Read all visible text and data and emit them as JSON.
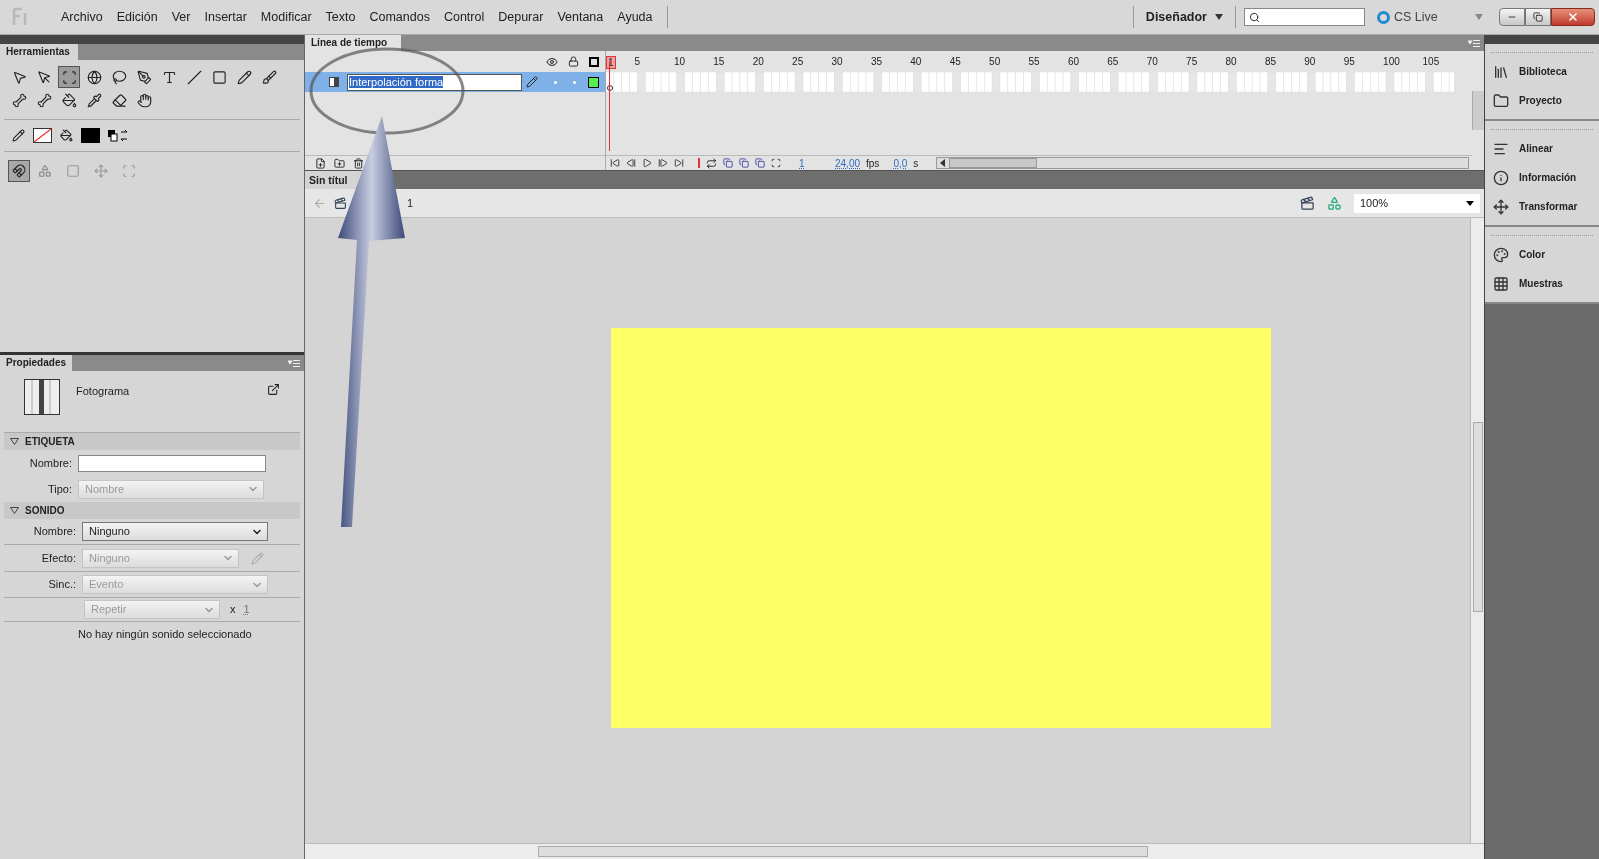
{
  "menu": {
    "items": [
      "Archivo",
      "Edición",
      "Ver",
      "Insertar",
      "Modificar",
      "Texto",
      "Comandos",
      "Control",
      "Depurar",
      "Ventana",
      "Ayuda"
    ],
    "workspace": "Diseñador",
    "cs_live": "CS Live"
  },
  "tools_panel": {
    "title": "Herramientas",
    "tools": [
      {
        "selected": false
      },
      {
        "selected": false
      },
      {
        "selected": true
      },
      {
        "selected": false
      },
      {
        "selected": false
      },
      {
        "selected": false
      },
      {
        "selected": false
      },
      {
        "selected": false
      },
      {
        "selected": false
      },
      {
        "selected": false
      },
      {
        "selected": false
      },
      {
        "selected": false
      },
      {
        "selected": false
      },
      {
        "selected": false
      },
      {
        "selected": false
      },
      {
        "selected": false
      },
      {
        "selected": false
      }
    ],
    "snap": {
      "on": true
    }
  },
  "timeline": {
    "title": "Línea de tiempo",
    "frame_labels": [
      "1",
      "5",
      "10",
      "15",
      "20",
      "25",
      "30",
      "35",
      "40",
      "45",
      "50",
      "55",
      "60",
      "65",
      "70",
      "75",
      "80",
      "85",
      "90",
      "95",
      "100",
      "105"
    ],
    "layers": [
      {
        "name": "Interpolación forma",
        "selected": true,
        "editing": true,
        "color": "#55ee55"
      }
    ],
    "status": {
      "frame": "1",
      "fps_value": "24,00",
      "fps_unit": "fps",
      "time_value": "0,0",
      "time_unit": "s"
    }
  },
  "document": {
    "tab": "Sin títul",
    "scene": "1",
    "zoom": "100%"
  },
  "properties": {
    "title": "Propiedades",
    "type": "Fotograma",
    "sections": [
      {
        "title": "ETIQUETA",
        "expanded": true,
        "rows": [
          {
            "kind": "input",
            "label": "Nombre:",
            "value": ""
          },
          {
            "kind": "select",
            "label": "Tipo:",
            "value": "Nombre",
            "disabled": true
          }
        ]
      },
      {
        "title": "SONIDO",
        "expanded": true,
        "rows": [
          {
            "kind": "select",
            "label": "Nombre:",
            "value": "Ninguno",
            "disabled": false
          },
          {
            "kind": "select-edit",
            "label": "Efecto:",
            "value": "Ninguno",
            "disabled": true
          },
          {
            "kind": "select",
            "label": "Sinc.:",
            "value": "Evento",
            "disabled": true
          },
          {
            "kind": "repeat",
            "value": "Repetir",
            "disabled": true,
            "times": "x",
            "count": "1"
          },
          {
            "kind": "message",
            "text": "No hay ningún sonido seleccionado"
          }
        ]
      }
    ]
  },
  "side_panels": [
    [
      "Biblioteca",
      "Proyecto"
    ],
    [
      "Alinear",
      "Información",
      "Transformar"
    ],
    [
      "Color",
      "Muestras"
    ]
  ]
}
